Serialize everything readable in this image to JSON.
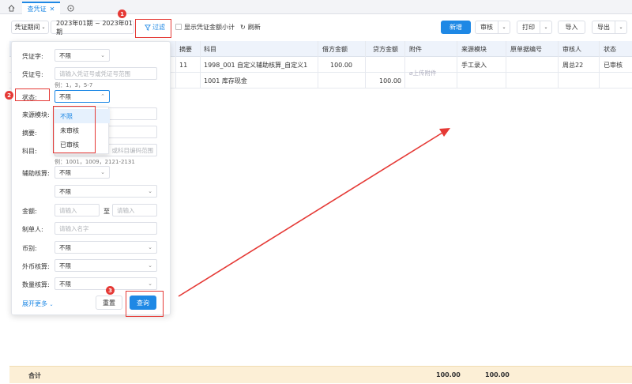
{
  "tabs": {
    "active": "查凭证"
  },
  "toolbar": {
    "period_label": "凭证期间",
    "period_range": "2023年01期 ~ 2023年01期",
    "filter": "过滤",
    "show_subtotal": "显示凭证金额小计",
    "refresh": "刷新",
    "new": "新增",
    "audit": "审核",
    "print": "打印",
    "import": "导入",
    "export": "导出"
  },
  "table": {
    "headers": [
      "摘要",
      "科目",
      "借方金额",
      "贷方金额",
      "附件",
      "来源模块",
      "原单据编号",
      "审核人",
      "状态"
    ],
    "rows": [
      {
        "summary": "11",
        "subject": "1998_001 自定义辅助核算_自定义1",
        "debit": "100.00",
        "credit": "",
        "attachment": "上传附件",
        "source": "手工录入",
        "orig_no": "",
        "auditor": "周总22",
        "status": "已审核"
      },
      {
        "summary": "",
        "subject": "1001 库存现金",
        "debit": "",
        "credit": "100.00",
        "attachment": "",
        "source": "",
        "orig_no": "",
        "auditor": "",
        "status": ""
      }
    ],
    "footer": {
      "label": "合计",
      "debit_total": "100.00",
      "credit_total": "100.00"
    }
  },
  "filter_panel": {
    "voucher_word": {
      "label": "凭证字:",
      "value": "不限"
    },
    "voucher_no": {
      "label": "凭证号:",
      "placeholder": "请输入凭证号或凭证号范围",
      "hint": "例：1，3，5-7"
    },
    "status": {
      "label": "状态:",
      "value": "不限",
      "options": [
        "不限",
        "未审核",
        "已审核"
      ]
    },
    "source_module": {
      "label": "来源模块:"
    },
    "summary": {
      "label": "摘要:"
    },
    "subject": {
      "label": "科目:",
      "placeholder": "或科目编码范围",
      "hint": "例：1001，1009，2121-2131"
    },
    "aux": {
      "label": "辅助核算:",
      "value": "不限",
      "value2": "不限"
    },
    "amount": {
      "label": "金额:",
      "placeholder_from": "请输入",
      "sep": "至",
      "placeholder_to": "请输入"
    },
    "maker": {
      "label": "制单人:",
      "placeholder": "请输入名字"
    },
    "currency": {
      "label": "币别:",
      "value": "不限"
    },
    "fx_accounting": {
      "label": "外币核算:",
      "value": "不限"
    },
    "qty_accounting": {
      "label": "数量核算:",
      "value": "不限"
    },
    "expand": "展开更多",
    "reset": "重置",
    "query": "查询"
  },
  "annotations": {
    "badge1": "1",
    "badge2": "2",
    "badge3": "3"
  },
  "colors": {
    "primary": "#1e88e5",
    "annotation": "#e53935",
    "footer_bg": "#fcefd6"
  }
}
